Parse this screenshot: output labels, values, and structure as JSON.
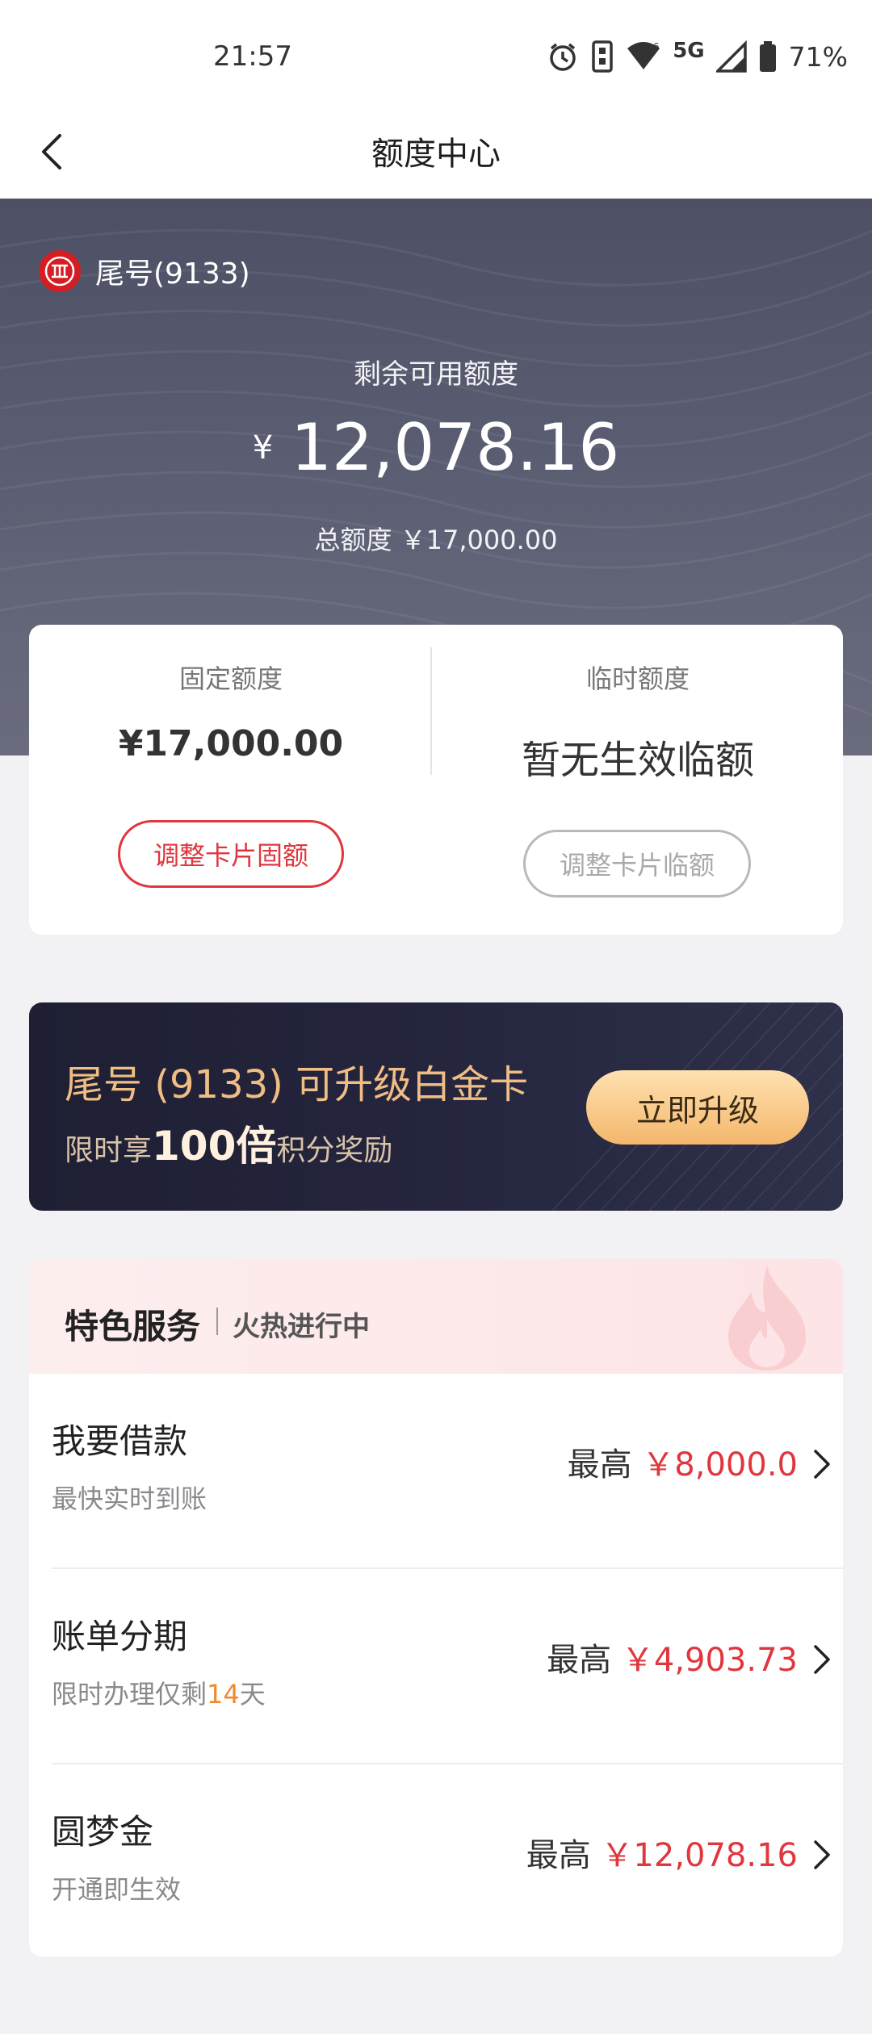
{
  "status_bar": {
    "time": "21:57",
    "network": "5G",
    "battery": "71%",
    "icons": [
      "alarm-icon",
      "vibrate-icon",
      "wifi-icon",
      "signal-icon",
      "battery-icon"
    ]
  },
  "nav": {
    "title": "额度中心",
    "back_icon": "chevron-left-icon"
  },
  "hero": {
    "card_label": "尾号(9133)",
    "available_label": "剩余可用额度",
    "currency": "¥",
    "available_amount": "12,078.16",
    "total_line": "总额度 ￥17,000.00"
  },
  "quota": {
    "fixed": {
      "label": "固定额度",
      "value": "¥17,000.00",
      "button": "调整卡片固额"
    },
    "temp": {
      "label": "临时额度",
      "value": "暂无生效临额",
      "button": "调整卡片临额"
    }
  },
  "upgrade": {
    "title": "尾号 (9133) 可升级白金卡",
    "sub_prefix": "限时享",
    "sub_big": "100倍",
    "sub_suffix": "积分奖励",
    "button": "立即升级"
  },
  "services": {
    "title": "特色服务",
    "subtitle": "火热进行中",
    "items": [
      {
        "title": "我要借款",
        "desc": "最快实时到账",
        "amount_prefix": "最高",
        "amount": "￥8,000.0"
      },
      {
        "title": "账单分期",
        "desc_prefix": "限时办理仅剩",
        "desc_highlight": "14",
        "desc_suffix": "天",
        "amount_prefix": "最高",
        "amount": "￥4,903.73"
      },
      {
        "title": "圆梦金",
        "desc": "开通即生效",
        "amount_prefix": "最高",
        "amount": "￥12,078.16"
      }
    ]
  },
  "colors": {
    "accent_red": "#e0363e",
    "hero_bg": "#555869",
    "gold": "#f0bd84",
    "highlight_orange": "#f08a2c"
  }
}
